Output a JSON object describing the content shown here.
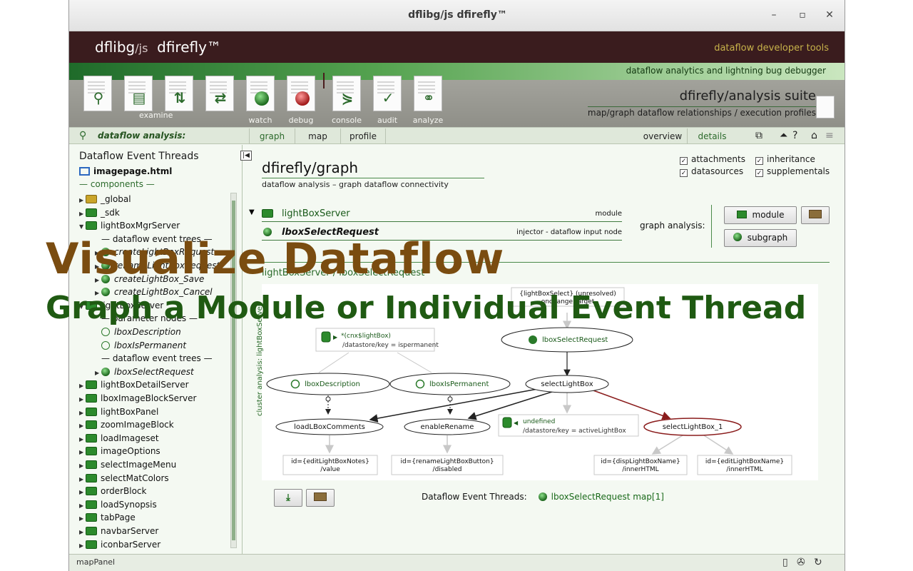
{
  "window": {
    "title": "dflibg/js dfirefly™",
    "min": "–",
    "max": "▫",
    "close": "✕"
  },
  "brand": {
    "logo": "dflibg",
    "logo_sub": "/js",
    "logo2": "dfirefly™",
    "tagline": "dataflow developer tools",
    "strip": "dataflow analytics and lightning bug debugger"
  },
  "tools": [
    {
      "icon": "magnifier-icon",
      "label": ""
    },
    {
      "icon": "data-pages-icon",
      "label": "examine"
    },
    {
      "icon": "up-down-icon",
      "label": ""
    },
    {
      "icon": "swap-icon",
      "label": ""
    },
    {
      "icon": "watch-bug-icon",
      "label": "watch"
    },
    {
      "icon": "debug-bug-icon",
      "label": "debug"
    },
    {
      "icon": "console-icon",
      "label": "console"
    },
    {
      "icon": "audit-check-icon",
      "label": "audit"
    },
    {
      "icon": "analyze-graph-icon",
      "label": "analyze"
    }
  ],
  "suite": {
    "title": "dfirefly/analysis suite",
    "subtitle": "map/graph dataflow relationships / execution profiles"
  },
  "nav": {
    "label": "dataflow analysis:",
    "tabs": [
      "graph",
      "map",
      "profile"
    ],
    "right_tabs": [
      "overview",
      "details"
    ]
  },
  "left": {
    "header": "Dataflow Event Threads",
    "page": "imagepage.html",
    "components": "— components —",
    "tree": [
      {
        "type": "mod-yellow",
        "tri": "▶",
        "label": "_global",
        "indent": 0
      },
      {
        "type": "mod",
        "tri": "▶",
        "label": "_sdk",
        "indent": 0
      },
      {
        "type": "mod",
        "tri": "▼",
        "label": "lightBoxMgrServer",
        "indent": 0
      },
      {
        "type": "sec",
        "tri": "",
        "label": "— dataflow event trees —",
        "indent": 1
      },
      {
        "type": "bug",
        "tri": "▶",
        "label": "createLightBoxRequest",
        "indent": 1
      },
      {
        "type": "bug",
        "tri": "▶",
        "label": "renameLightBoxRequest",
        "indent": 1
      },
      {
        "type": "bug",
        "tri": "▶",
        "label": "createLightBox_Save",
        "indent": 1
      },
      {
        "type": "bug",
        "tri": "▶",
        "label": "createLightBox_Cancel",
        "indent": 1
      },
      {
        "type": "mod",
        "tri": "▼",
        "label": "lightBoxServer",
        "indent": 0
      },
      {
        "type": "sec",
        "tri": "",
        "label": "— parameter nodes —",
        "indent": 1
      },
      {
        "type": "ring",
        "tri": "",
        "label": "lboxDescription",
        "indent": 1
      },
      {
        "type": "ring",
        "tri": "",
        "label": "lboxIsPermanent",
        "indent": 1
      },
      {
        "type": "sec",
        "tri": "",
        "label": "— dataflow event trees —",
        "indent": 1
      },
      {
        "type": "bug",
        "tri": "▶",
        "label": "lboxSelectRequest",
        "indent": 1
      },
      {
        "type": "mod",
        "tri": "▶",
        "label": "lightBoxDetailServer",
        "indent": 0
      },
      {
        "type": "mod",
        "tri": "▶",
        "label": "lboxImageBlockServer",
        "indent": 0
      },
      {
        "type": "mod",
        "tri": "▶",
        "label": "lightBoxPanel",
        "indent": 0
      },
      {
        "type": "mod",
        "tri": "▶",
        "label": "zoomImageBlock",
        "indent": 0
      },
      {
        "type": "mod",
        "tri": "▶",
        "label": "loadImageset",
        "indent": 0
      },
      {
        "type": "mod",
        "tri": "▶",
        "label": "imageOptions",
        "indent": 0
      },
      {
        "type": "mod",
        "tri": "▶",
        "label": "selectImageMenu",
        "indent": 0
      },
      {
        "type": "mod",
        "tri": "▶",
        "label": "selectMatColors",
        "indent": 0
      },
      {
        "type": "mod",
        "tri": "▶",
        "label": "orderBlock",
        "indent": 0
      },
      {
        "type": "mod",
        "tri": "▶",
        "label": "loadSynopsis",
        "indent": 0
      },
      {
        "type": "mod",
        "tri": "▶",
        "label": "tabPage",
        "indent": 0
      },
      {
        "type": "mod",
        "tri": "▶",
        "label": "navbarServer",
        "indent": 0
      },
      {
        "type": "mod",
        "tri": "▶",
        "label": "iconbarServer",
        "indent": 0
      }
    ]
  },
  "main": {
    "title": "dfirefly/graph",
    "subtitle": "dataflow analysis – graph dataflow connectivity",
    "checks": [
      {
        "label": "attachments",
        "checked": "✓"
      },
      {
        "label": "inheritance",
        "checked": "✓"
      },
      {
        "label": "datasources",
        "checked": "✓"
      },
      {
        "label": "supplementals",
        "checked": "✓"
      }
    ],
    "rows": [
      {
        "name": "lightBoxServer",
        "type": "module"
      },
      {
        "name": "lboxSelectRequest",
        "type": "injector - dataflow input node"
      }
    ],
    "graph_analysis_label": "graph analysis:",
    "btn_module": "module",
    "btn_subgraph": "subgraph",
    "graph_label": "lightBoxServer / lboxSelectRequest",
    "cluster_label": "cluster analysis: lightBoxServer",
    "threads_label": "Dataflow Event Threads:",
    "threads_value": "lboxSelectRequest map[1]",
    "graph": {
      "n_top_line1": "{lightBoxSelect} (unresolved)",
      "n_top_line2": "onchange.target",
      "n_ds_line1": "*(cnx$lightBox)",
      "n_ds_line2": "/datastore/key = ispermanent",
      "n_req": "lboxSelectRequest",
      "n_desc": "lboxDescription",
      "n_perm": "lboxIsPermanent",
      "n_select": "selectLightBox",
      "n_load": "loadLBoxComments",
      "n_rename": "enableRename",
      "n_undef_line1": "undefined",
      "n_undef_line2": "/datastore/key = activeLightBox",
      "n_select1": "selectLightBox_1",
      "d1_line1": "id={editLightBoxNotes}",
      "d1_line2": "/value",
      "d2_line1": "id={renameLightBoxButton}",
      "d2_line2": "/disabled",
      "d3_line1": "id={dispLightBoxName}",
      "d3_line2": "/innerHTML",
      "d4_line1": "id={editLightBoxName}",
      "d4_line2": "/innerHTML"
    }
  },
  "status": {
    "label": "mapPanel"
  },
  "overlay": {
    "line1": "Visualize Dataflow",
    "line2": "Graph a Module or Individual Event Thread"
  }
}
